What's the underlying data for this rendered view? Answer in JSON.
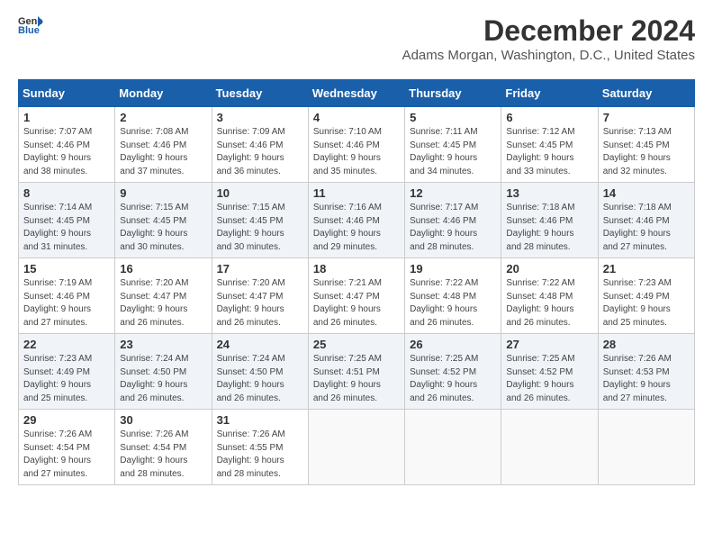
{
  "app": {
    "logo_line1": "General",
    "logo_line2": "Blue",
    "title": "December 2024",
    "location": "Adams Morgan, Washington, D.C., United States"
  },
  "calendar": {
    "headers": [
      "Sunday",
      "Monday",
      "Tuesday",
      "Wednesday",
      "Thursday",
      "Friday",
      "Saturday"
    ],
    "weeks": [
      [
        {
          "day": "",
          "info": ""
        },
        {
          "day": "2",
          "info": "Sunrise: 7:08 AM\nSunset: 4:46 PM\nDaylight: 9 hours\nand 37 minutes."
        },
        {
          "day": "3",
          "info": "Sunrise: 7:09 AM\nSunset: 4:46 PM\nDaylight: 9 hours\nand 36 minutes."
        },
        {
          "day": "4",
          "info": "Sunrise: 7:10 AM\nSunset: 4:46 PM\nDaylight: 9 hours\nand 35 minutes."
        },
        {
          "day": "5",
          "info": "Sunrise: 7:11 AM\nSunset: 4:45 PM\nDaylight: 9 hours\nand 34 minutes."
        },
        {
          "day": "6",
          "info": "Sunrise: 7:12 AM\nSunset: 4:45 PM\nDaylight: 9 hours\nand 33 minutes."
        },
        {
          "day": "7",
          "info": "Sunrise: 7:13 AM\nSunset: 4:45 PM\nDaylight: 9 hours\nand 32 minutes."
        }
      ],
      [
        {
          "day": "1",
          "info": "Sunrise: 7:07 AM\nSunset: 4:46 PM\nDaylight: 9 hours\nand 38 minutes."
        },
        {
          "day": "",
          "info": ""
        },
        {
          "day": "",
          "info": ""
        },
        {
          "day": "",
          "info": ""
        },
        {
          "day": "",
          "info": ""
        },
        {
          "day": "",
          "info": ""
        },
        {
          "day": "",
          "info": ""
        }
      ],
      [
        {
          "day": "8",
          "info": "Sunrise: 7:14 AM\nSunset: 4:45 PM\nDaylight: 9 hours\nand 31 minutes."
        },
        {
          "day": "9",
          "info": "Sunrise: 7:15 AM\nSunset: 4:45 PM\nDaylight: 9 hours\nand 30 minutes."
        },
        {
          "day": "10",
          "info": "Sunrise: 7:15 AM\nSunset: 4:45 PM\nDaylight: 9 hours\nand 30 minutes."
        },
        {
          "day": "11",
          "info": "Sunrise: 7:16 AM\nSunset: 4:46 PM\nDaylight: 9 hours\nand 29 minutes."
        },
        {
          "day": "12",
          "info": "Sunrise: 7:17 AM\nSunset: 4:46 PM\nDaylight: 9 hours\nand 28 minutes."
        },
        {
          "day": "13",
          "info": "Sunrise: 7:18 AM\nSunset: 4:46 PM\nDaylight: 9 hours\nand 28 minutes."
        },
        {
          "day": "14",
          "info": "Sunrise: 7:18 AM\nSunset: 4:46 PM\nDaylight: 9 hours\nand 27 minutes."
        }
      ],
      [
        {
          "day": "15",
          "info": "Sunrise: 7:19 AM\nSunset: 4:46 PM\nDaylight: 9 hours\nand 27 minutes."
        },
        {
          "day": "16",
          "info": "Sunrise: 7:20 AM\nSunset: 4:47 PM\nDaylight: 9 hours\nand 26 minutes."
        },
        {
          "day": "17",
          "info": "Sunrise: 7:20 AM\nSunset: 4:47 PM\nDaylight: 9 hours\nand 26 minutes."
        },
        {
          "day": "18",
          "info": "Sunrise: 7:21 AM\nSunset: 4:47 PM\nDaylight: 9 hours\nand 26 minutes."
        },
        {
          "day": "19",
          "info": "Sunrise: 7:22 AM\nSunset: 4:48 PM\nDaylight: 9 hours\nand 26 minutes."
        },
        {
          "day": "20",
          "info": "Sunrise: 7:22 AM\nSunset: 4:48 PM\nDaylight: 9 hours\nand 26 minutes."
        },
        {
          "day": "21",
          "info": "Sunrise: 7:23 AM\nSunset: 4:49 PM\nDaylight: 9 hours\nand 25 minutes."
        }
      ],
      [
        {
          "day": "22",
          "info": "Sunrise: 7:23 AM\nSunset: 4:49 PM\nDaylight: 9 hours\nand 25 minutes."
        },
        {
          "day": "23",
          "info": "Sunrise: 7:24 AM\nSunset: 4:50 PM\nDaylight: 9 hours\nand 26 minutes."
        },
        {
          "day": "24",
          "info": "Sunrise: 7:24 AM\nSunset: 4:50 PM\nDaylight: 9 hours\nand 26 minutes."
        },
        {
          "day": "25",
          "info": "Sunrise: 7:25 AM\nSunset: 4:51 PM\nDaylight: 9 hours\nand 26 minutes."
        },
        {
          "day": "26",
          "info": "Sunrise: 7:25 AM\nSunset: 4:52 PM\nDaylight: 9 hours\nand 26 minutes."
        },
        {
          "day": "27",
          "info": "Sunrise: 7:25 AM\nSunset: 4:52 PM\nDaylight: 9 hours\nand 26 minutes."
        },
        {
          "day": "28",
          "info": "Sunrise: 7:26 AM\nSunset: 4:53 PM\nDaylight: 9 hours\nand 27 minutes."
        }
      ],
      [
        {
          "day": "29",
          "info": "Sunrise: 7:26 AM\nSunset: 4:54 PM\nDaylight: 9 hours\nand 27 minutes."
        },
        {
          "day": "30",
          "info": "Sunrise: 7:26 AM\nSunset: 4:54 PM\nDaylight: 9 hours\nand 28 minutes."
        },
        {
          "day": "31",
          "info": "Sunrise: 7:26 AM\nSunset: 4:55 PM\nDaylight: 9 hours\nand 28 minutes."
        },
        {
          "day": "",
          "info": ""
        },
        {
          "day": "",
          "info": ""
        },
        {
          "day": "",
          "info": ""
        },
        {
          "day": "",
          "info": ""
        }
      ]
    ]
  }
}
